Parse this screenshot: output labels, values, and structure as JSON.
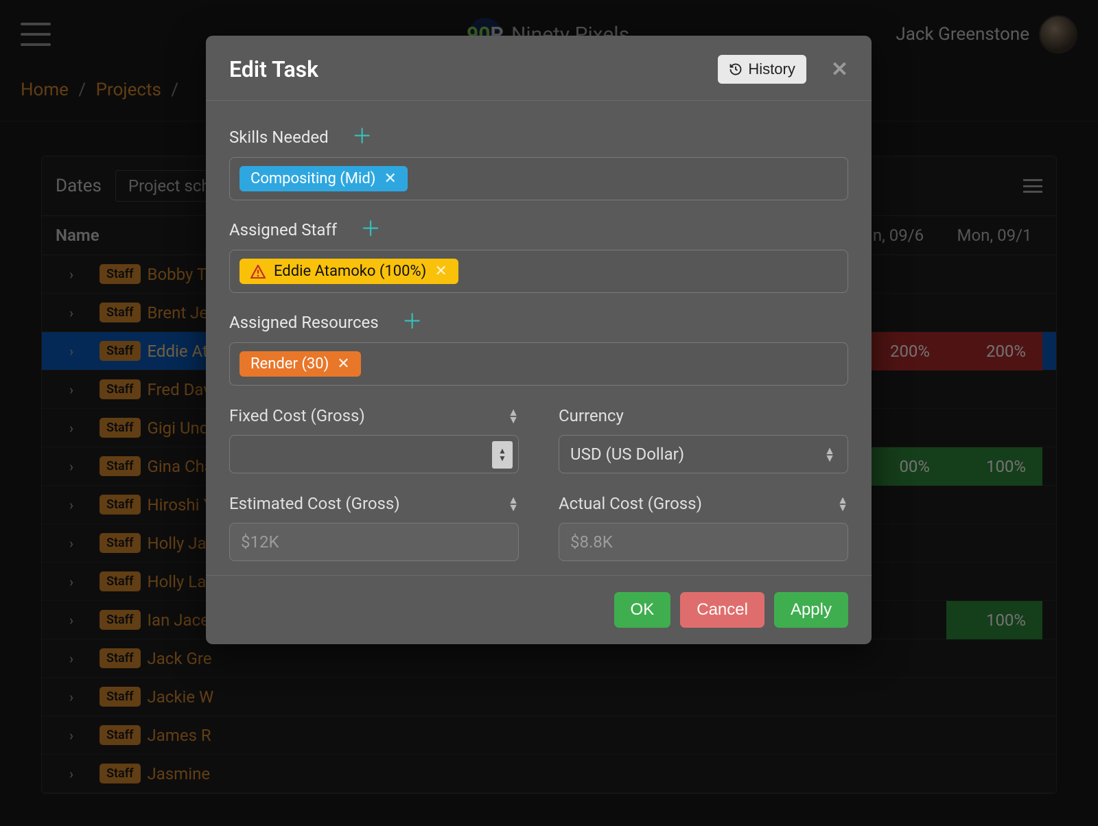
{
  "app": {
    "brand_text": "Ninety Pixels",
    "user_name": "Jack Greenstone"
  },
  "breadcrumbs": {
    "home": "Home",
    "projects": "Projects"
  },
  "table": {
    "dates_label": "Dates",
    "view_name": "Project sch",
    "header_name": "Name",
    "date_col_1": "n, 09/6",
    "date_col_2": "Mon, 09/1",
    "badge_label": "Staff",
    "rows": [
      {
        "name": "Bobby T"
      },
      {
        "name": "Brent Je"
      },
      {
        "name": "Eddie At",
        "selected": true,
        "pct": [
          {
            "v": "200%",
            "cls": "red w1"
          },
          {
            "v": "200%",
            "cls": "red w2"
          }
        ]
      },
      {
        "name": "Fred Dav"
      },
      {
        "name": "Gigi Und"
      },
      {
        "name": "Gina Cha",
        "pct": [
          {
            "v": "00%",
            "cls": "green w1"
          },
          {
            "v": "100%",
            "cls": "green w2"
          }
        ]
      },
      {
        "name": "Hiroshi Y"
      },
      {
        "name": "Holly Ja"
      },
      {
        "name": "Holly La"
      },
      {
        "name": "Ian Jace",
        "pct": [
          {
            "v": "100%",
            "cls": "green w2"
          }
        ]
      },
      {
        "name": "Jack Gre"
      },
      {
        "name": "Jackie W"
      },
      {
        "name": "James R"
      },
      {
        "name": "Jasmine"
      }
    ]
  },
  "modal": {
    "title": "Edit Task",
    "history_label": "History",
    "skills_label": "Skills Needed",
    "skill_chip": "Compositing (Mid)",
    "staff_label": "Assigned Staff",
    "staff_chip": "Eddie Atamoko (100%)",
    "resources_label": "Assigned Resources",
    "resource_chip": "Render (30)",
    "fixed_cost_label": "Fixed Cost (Gross)",
    "currency_label": "Currency",
    "currency_value": "USD (US Dollar)",
    "est_cost_label": "Estimated Cost (Gross)",
    "est_cost_value": "$12K",
    "actual_cost_label": "Actual Cost (Gross)",
    "actual_cost_value": "$8.8K",
    "ok_label": "OK",
    "cancel_label": "Cancel",
    "apply_label": "Apply"
  }
}
